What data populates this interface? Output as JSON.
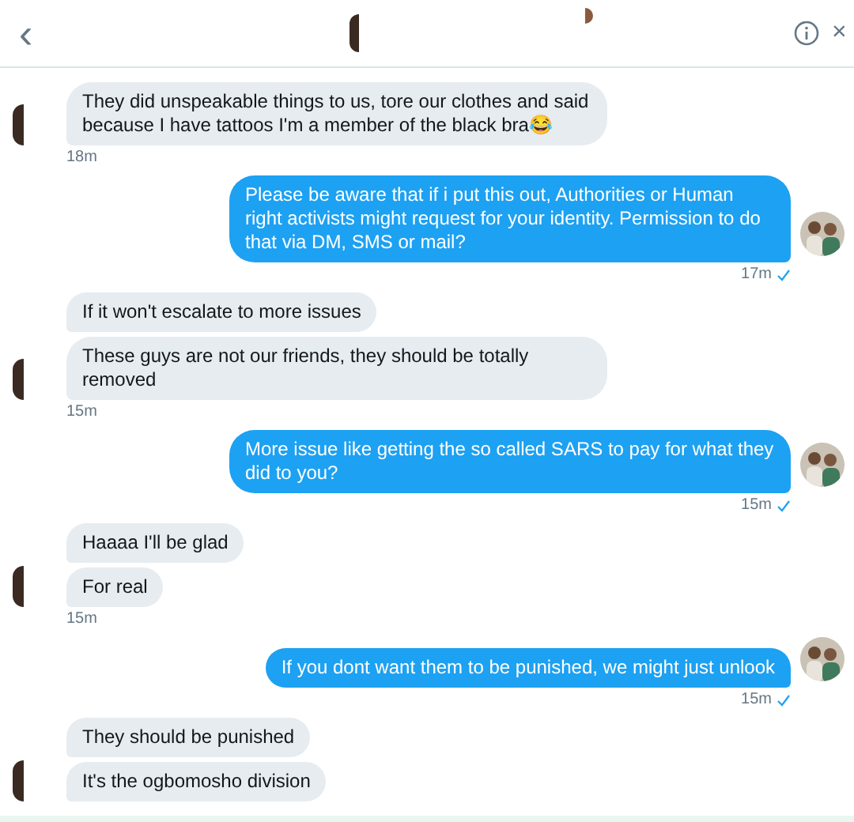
{
  "header": {
    "back": "‹",
    "close": "×"
  },
  "messages": [
    {
      "kind": "received",
      "bubbles": [
        "They did unspeakable things to us, tore our clothes and said because I have tattoos I'm a member of the black bra😂"
      ],
      "time": "18m"
    },
    {
      "kind": "sent",
      "bubbles": [
        "Please be aware that if i put this out, Authorities or Human right activists might request for your identity. Permission to do that via DM, SMS or mail?"
      ],
      "time": "17m",
      "read": true
    },
    {
      "kind": "received",
      "bubbles": [
        "If it won't escalate to more issues",
        "These guys are not our friends, they should be totally removed"
      ],
      "time": "15m"
    },
    {
      "kind": "sent",
      "bubbles": [
        "More issue like getting the so called SARS to pay for what they did to you?"
      ],
      "time": "15m",
      "read": true
    },
    {
      "kind": "received",
      "bubbles": [
        "Haaaa I'll be glad",
        "For real"
      ],
      "time": "15m"
    },
    {
      "kind": "sent",
      "bubbles": [
        "If you dont want them to be punished, we might just unlook"
      ],
      "time": "15m",
      "read": true
    },
    {
      "kind": "received",
      "bubbles": [
        "They should be punished",
        "It's the ogbomosho division"
      ]
    }
  ]
}
